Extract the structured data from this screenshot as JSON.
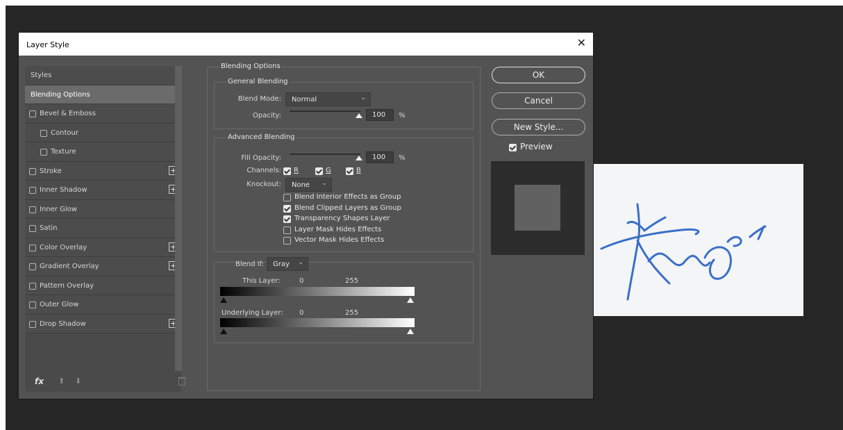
{
  "dialog": {
    "title": "Layer Style",
    "close_glyph": "✕",
    "buttons": {
      "ok": "OK",
      "cancel": "Cancel",
      "new_style": "New Style...",
      "preview": "Preview"
    }
  },
  "styles_panel": {
    "header": "Styles",
    "items": [
      {
        "label": "Blending Options",
        "active": true,
        "checkbox": false,
        "indent": false,
        "plus": false
      },
      {
        "label": "Bevel & Emboss",
        "checkbox": true,
        "checked": false,
        "indent": false,
        "plus": false
      },
      {
        "label": "Contour",
        "checkbox": true,
        "checked": false,
        "indent": true,
        "plus": false
      },
      {
        "label": "Texture",
        "checkbox": true,
        "checked": false,
        "indent": true,
        "plus": false
      },
      {
        "label": "Stroke",
        "checkbox": true,
        "checked": false,
        "indent": false,
        "plus": true
      },
      {
        "label": "Inner Shadow",
        "checkbox": true,
        "checked": false,
        "indent": false,
        "plus": true
      },
      {
        "label": "Inner Glow",
        "checkbox": true,
        "checked": false,
        "indent": false,
        "plus": false
      },
      {
        "label": "Satin",
        "checkbox": true,
        "checked": false,
        "indent": false,
        "plus": false
      },
      {
        "label": "Color Overlay",
        "checkbox": true,
        "checked": false,
        "indent": false,
        "plus": true
      },
      {
        "label": "Gradient Overlay",
        "checkbox": true,
        "checked": false,
        "indent": false,
        "plus": true
      },
      {
        "label": "Pattern Overlay",
        "checkbox": true,
        "checked": false,
        "indent": false,
        "plus": false
      },
      {
        "label": "Outer Glow",
        "checkbox": true,
        "checked": false,
        "indent": false,
        "plus": false
      },
      {
        "label": "Drop Shadow",
        "checkbox": true,
        "checked": false,
        "indent": false,
        "plus": true
      }
    ],
    "footer": {
      "fx_label": "fx",
      "up_glyph": "⬆",
      "down_glyph": "⬇"
    }
  },
  "blending_options": {
    "section_title": "Blending Options",
    "general": {
      "title": "General Blending",
      "blend_mode_label": "Blend Mode:",
      "blend_mode_value": "Normal",
      "opacity_label": "Opacity:",
      "opacity_value": "100",
      "opacity_unit": "%"
    },
    "advanced": {
      "title": "Advanced Blending",
      "fill_opacity_label": "Fill Opacity:",
      "fill_opacity_value": "100",
      "fill_opacity_unit": "%",
      "channels_label": "Channels:",
      "channels": [
        "R",
        "G",
        "B"
      ],
      "knockout_label": "Knockout:",
      "knockout_value": "None",
      "options": [
        {
          "label": "Blend Interior Effects as Group",
          "checked": false
        },
        {
          "label": "Blend Clipped Layers as Group",
          "checked": true
        },
        {
          "label": "Transparency Shapes Layer",
          "checked": true
        },
        {
          "label": "Layer Mask Hides Effects",
          "checked": false
        },
        {
          "label": "Vector Mask Hides Effects",
          "checked": false
        }
      ]
    },
    "blend_if": {
      "label": "Blend If:",
      "value": "Gray",
      "this_layer_label": "This Layer:",
      "this_layer_low": "0",
      "this_layer_high": "255",
      "underlying_label": "Underlying Layer:",
      "underlying_low": "0",
      "underlying_high": "255"
    }
  },
  "colors": {
    "dialog_bg": "#535353",
    "workspace_bg": "#262626",
    "ink": "#3a6fc8"
  }
}
